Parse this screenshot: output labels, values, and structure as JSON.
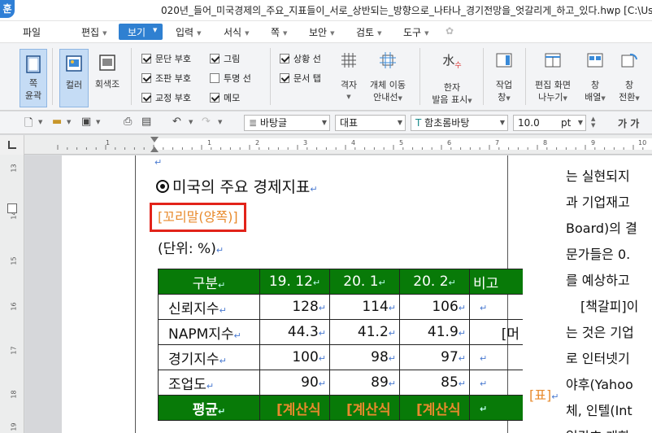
{
  "titlebar": {
    "logo": "훈",
    "title": "020년_들어_미국경제의_주요_지표들이_서로_상반되는_방향으로_나타나_경기전망을_엇갈리게_하고_있다.hwp [C:\\Users"
  },
  "menu": {
    "file": "파일",
    "edit": "편집",
    "view": "보기",
    "input": "입력",
    "format": "서식",
    "page": "쪽",
    "security": "보안",
    "review": "검토",
    "tools": "도구"
  },
  "ribbon": {
    "page_outline": [
      "쪽",
      "윤곽"
    ],
    "color": "컬러",
    "grayscale": "회색조",
    "checks": {
      "para_mark": {
        "label": "문단 부호",
        "checked": true
      },
      "grid": {
        "label": "그림",
        "checked": true
      },
      "status_line": {
        "label": "상황 선",
        "checked": true
      },
      "format_mark": {
        "label": "조판 부호",
        "checked": true
      },
      "transparent_line": {
        "label": "투명 선",
        "checked": false
      },
      "doc_tab": {
        "label": "문서 탭",
        "checked": true
      },
      "proof_mark": {
        "label": "교정 부호",
        "checked": true
      },
      "memo": {
        "label": "메모",
        "checked": true
      }
    },
    "grid": "격자",
    "object_move": [
      "개체 이동",
      "안내선"
    ],
    "hanja": [
      "한자",
      "발음 표시"
    ],
    "work_window": [
      "작업",
      "창"
    ],
    "split_screen": [
      "편집 화면",
      "나누기"
    ],
    "arrange_window": [
      "창",
      "배열"
    ],
    "switch_window": [
      "창",
      "전환"
    ]
  },
  "toolbar": {
    "style": "바탕글",
    "representative": "대표",
    "font": "함초롬바탕",
    "size": "10.0",
    "unit": "pt",
    "bold_italic": "가 가"
  },
  "ruler": {
    "h_numbers": [
      "1",
      "1",
      "2",
      "3",
      "4",
      "5",
      "6",
      "7",
      "8",
      "9",
      "10"
    ],
    "v_numbers": [
      "13",
      "14",
      "15",
      "16",
      "17",
      "18",
      "19"
    ]
  },
  "document": {
    "title": "미국의 주요 경제지표",
    "footnote_tag": "[꼬리말(양쪽)]",
    "unit": "(단위: %)",
    "table": {
      "headers": [
        "구분",
        "19. 12",
        "20. 1",
        "20. 2",
        "비고"
      ],
      "rows": [
        [
          "신뢰지수",
          "128",
          "114",
          "106",
          ""
        ],
        [
          "NAPM지수",
          "44.3",
          "41.2",
          "41.9",
          "[머"
        ],
        [
          "경기지수",
          "100",
          "98",
          "97",
          ""
        ],
        [
          "조업도",
          "90",
          "89",
          "85",
          ""
        ]
      ],
      "footer": [
        "평균",
        "[계산식",
        "[계산식",
        "[계산식",
        ""
      ]
    },
    "table_tag": "[표]",
    "right_col": [
      "는 실현되지",
      "과 기업재고",
      "Board)의 결",
      "문가들은 0.",
      "를 예상하고",
      "[책갈피]이",
      "는 것은 기업",
      "로 인터넷기",
      "야후(Yahoo",
      "체, 인텔(Int",
      "일각호 개화"
    ]
  },
  "colors": {
    "accent": "#2f80d1",
    "table_header": "#087a08",
    "field_text": "#e88a2c",
    "highlight_border": "#e2231a"
  }
}
